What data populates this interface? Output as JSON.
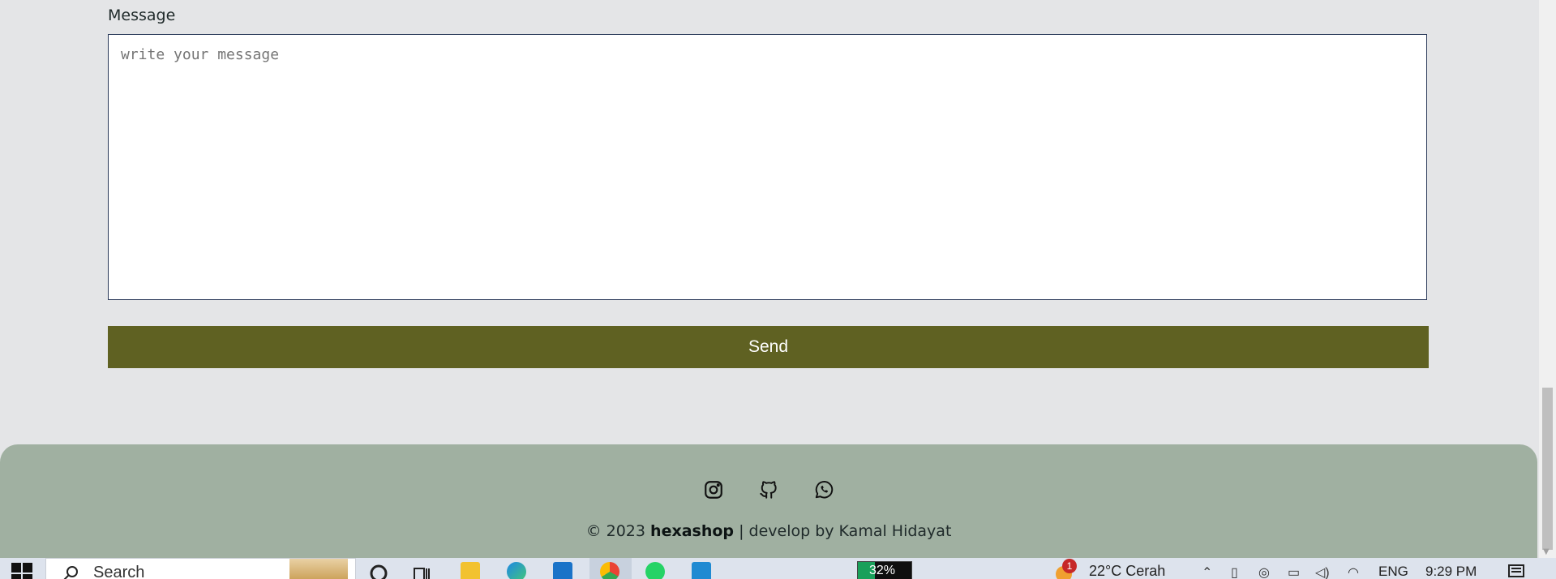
{
  "contact_form": {
    "message_label": "Message",
    "message_placeholder": "write your message",
    "send_label": "Send"
  },
  "footer": {
    "socials": [
      {
        "name": "instagram-icon"
      },
      {
        "name": "github-icon"
      },
      {
        "name": "whatsapp-icon"
      }
    ],
    "copyright_prefix": "© 2023",
    "brand": "hexashop",
    "copyright_suffix": "| develop by Kamal Hidayat"
  },
  "taskbar": {
    "search_placeholder": "Search",
    "battery_percent": "32%",
    "battery_level": 0.32,
    "notification_count": "1",
    "weather": "22°C  Cerah",
    "language": "ENG",
    "time": "9:29 PM"
  },
  "colors": {
    "send_button": "#5f6122",
    "footer_bg": "#a0b0a1",
    "page_bg": "#e4e5e7"
  }
}
